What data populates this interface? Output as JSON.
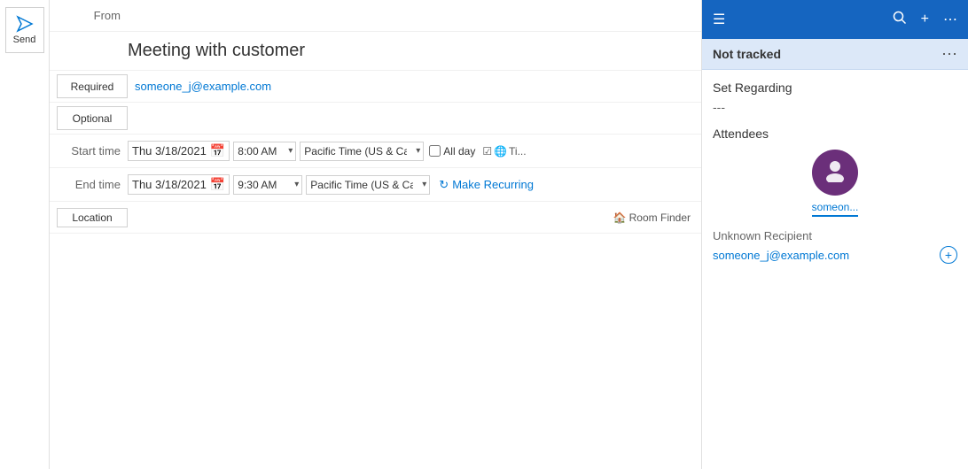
{
  "send_button": {
    "label": "Send"
  },
  "compose": {
    "from_label": "From",
    "title": "Meeting with customer",
    "required_label": "Required",
    "optional_label": "Optional",
    "required_email": "someone_j@example.com",
    "start_time_label": "Start time",
    "end_time_label": "End time",
    "location_label": "Location",
    "start_date": "Thu 3/18/2021",
    "start_time": "8:00 AM",
    "end_date": "Thu 3/18/2021",
    "end_time": "9:30 AM",
    "timezone": "Pacific Time (US & Cana...",
    "allday_label": "All day",
    "recurring_label": "Make Recurring",
    "room_finder_label": "Room Finder"
  },
  "right_panel": {
    "header_icons": {
      "menu": "☰",
      "search": "🔍",
      "add": "+",
      "more": "⋯"
    },
    "not_tracked": "Not tracked",
    "not_tracked_more": "⋯",
    "set_regarding": "Set Regarding",
    "regarding_value": "---",
    "attendees_label": "Attendees",
    "attendee_name": "someon...",
    "unknown_recipient_label": "Unknown Recipient",
    "unknown_email": "someone_j@example.com"
  }
}
